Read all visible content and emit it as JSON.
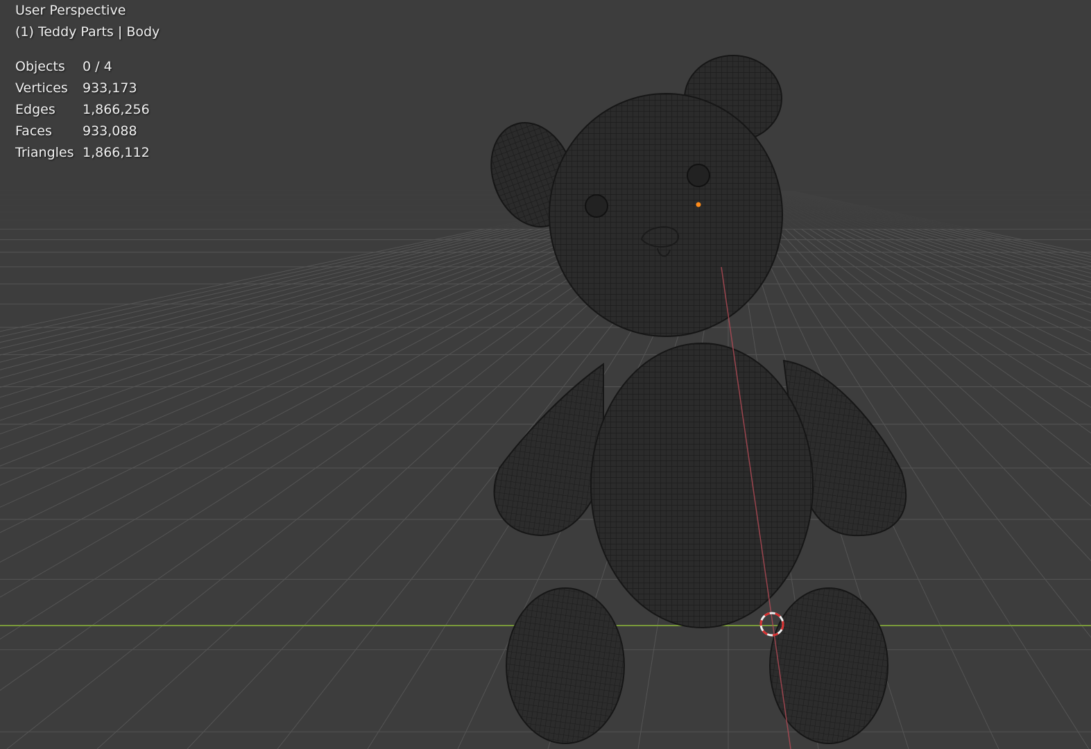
{
  "viewport": {
    "title": "User Perspective",
    "context": "(1) Teddy Parts | Body",
    "stats": [
      {
        "label": "Objects",
        "value": "0 / 4"
      },
      {
        "label": "Vertices",
        "value": "933,173"
      },
      {
        "label": "Edges",
        "value": "1,866,256"
      },
      {
        "label": "Faces",
        "value": "933,088"
      },
      {
        "label": "Triangles",
        "value": "1,866,112"
      }
    ]
  },
  "colors": {
    "background": "#3d3d3d",
    "grid_line": "#555555",
    "x_axis": "#7a9a3a",
    "y_axis": "#b04a55",
    "mesh_fill": "#2b2b2b",
    "mesh_wire": "#1a1a1a",
    "origin_dot": "#ff8c1a",
    "cursor_red": "#d83030",
    "cursor_white": "#f0f0f0",
    "text": "#f2f2f2"
  },
  "icons": {
    "cursor": "3d-cursor-icon",
    "origin": "object-origin-icon"
  },
  "scene": {
    "object_name": "Teddy Parts",
    "mode": "wireframe"
  }
}
